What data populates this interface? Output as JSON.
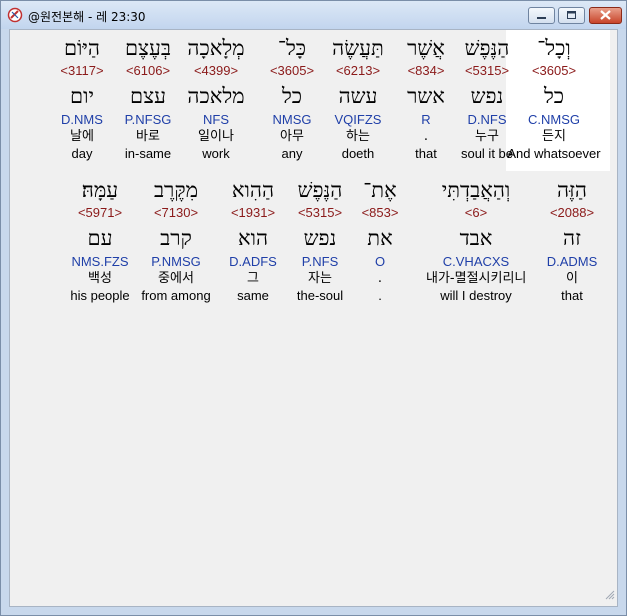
{
  "window": {
    "title": "@원전본해 - 레 23:30",
    "accent_color": "#c2d5ee",
    "close_color": "#c8442a"
  },
  "rows": [
    {
      "words": [
        {
          "hebrew": "וְכָל־",
          "strong": "<3605>",
          "lemma": "כל",
          "morph": "C.NMSG",
          "korean": "든지",
          "english": "And whatsoever",
          "highlighted": true
        },
        {
          "hebrew": "הַנֶּפֶשׁ",
          "strong": "<5315>",
          "lemma": "נפש",
          "morph": "D.NFS",
          "korean": "누구",
          "english": "soul it be"
        },
        {
          "hebrew": "אֲשֶׁר",
          "strong": "<834>",
          "lemma": "אשר",
          "morph": "R",
          "korean": ".",
          "english": "that"
        },
        {
          "hebrew": "תַּעֲשֶׂה",
          "strong": "<6213>",
          "lemma": "עשה",
          "morph": "VQIFZS",
          "korean": "하는",
          "english": "doeth"
        },
        {
          "hebrew": "כָּל־",
          "strong": "<3605>",
          "lemma": "כל",
          "morph": "NMSG",
          "korean": "아무",
          "english": "any"
        },
        {
          "hebrew": "מְלָאכָה",
          "strong": "<4399>",
          "lemma": "מלאכה",
          "morph": "NFS",
          "korean": "일이나",
          "english": "work"
        },
        {
          "hebrew": "בְּעֶצֶם",
          "strong": "<6106>",
          "lemma": "עצם",
          "morph": "P.NFSG",
          "korean": "바로",
          "english": "in-same"
        },
        {
          "hebrew": "הַיּוֹם",
          "strong": "<3117>",
          "lemma": "יום",
          "morph": "D.NMS",
          "korean": "날에",
          "english": "day"
        }
      ]
    },
    {
      "words": [
        {
          "hebrew": "הַזֶּה",
          "strong": "<2088>",
          "lemma": "זה",
          "morph": "D.ADMS",
          "korean": "이",
          "english": "that"
        },
        {
          "hebrew": "וְהַאֲבַדְתִּי",
          "strong": "<6>",
          "lemma": "אבד",
          "morph": "C.VHACXS",
          "korean": "내가-멸절시키리니",
          "english": "will I destroy"
        },
        {
          "hebrew": "אֶת־",
          "strong": "<853>",
          "lemma": "את",
          "morph": "O",
          "korean": ".",
          "english": "."
        },
        {
          "hebrew": "הַנֶּפֶשׁ",
          "strong": "<5315>",
          "lemma": "נפש",
          "morph": "P.NFS",
          "korean": "자는",
          "english": "the-soul"
        },
        {
          "hebrew": "הַהִוא",
          "strong": "<1931>",
          "lemma": "הוא",
          "morph": "D.ADFS",
          "korean": "그",
          "english": "same"
        },
        {
          "hebrew": "מִקֶּרֶב",
          "strong": "<7130>",
          "lemma": "קרב",
          "morph": "P.NMSG",
          "korean": "중에서",
          "english": "from among"
        },
        {
          "hebrew": "עַמָּהּ׃",
          "strong": "<5971>",
          "lemma": "עם",
          "morph": "NMS.FZS",
          "korean": "백성",
          "english": "his people"
        }
      ]
    }
  ]
}
